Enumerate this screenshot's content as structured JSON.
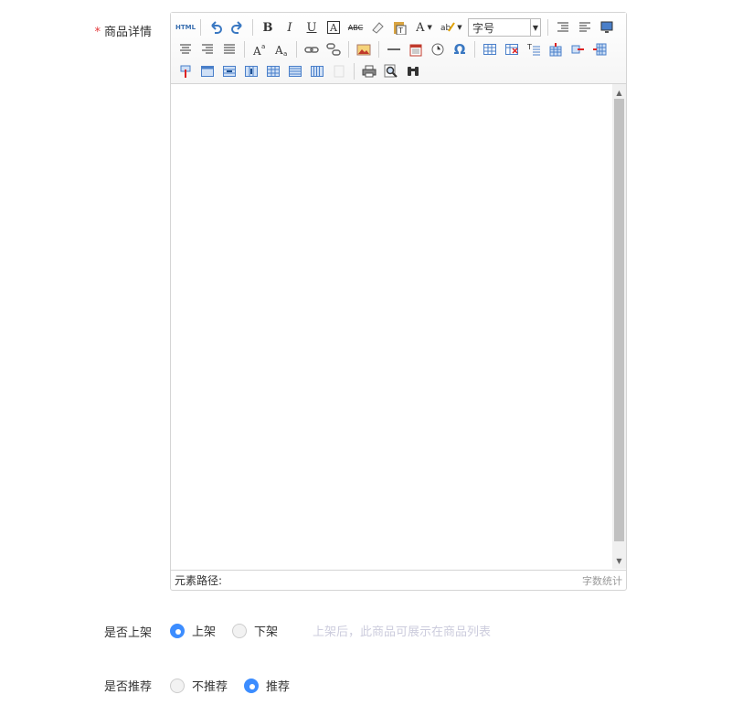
{
  "detail": {
    "required_mark": "*",
    "label": "商品详情",
    "toolbar": {
      "html_label": "HTML",
      "bold_label": "B",
      "italic_label": "I",
      "underline_label": "U",
      "strike_label": "ABC",
      "fontcolor_label": "A",
      "fontsize_label": "字号",
      "special_char_label": "Ω"
    },
    "status": {
      "path_label": "元素路径:",
      "count_label": "字数统计"
    }
  },
  "onsale": {
    "label": "是否上架",
    "options": [
      {
        "label": "上架",
        "selected": true
      },
      {
        "label": "下架",
        "selected": false
      }
    ],
    "hint": "上架后，此商品可展示在商品列表"
  },
  "recommend": {
    "label": "是否推荐",
    "options": [
      {
        "label": "不推荐",
        "selected": false
      },
      {
        "label": "推荐",
        "selected": true
      }
    ]
  }
}
